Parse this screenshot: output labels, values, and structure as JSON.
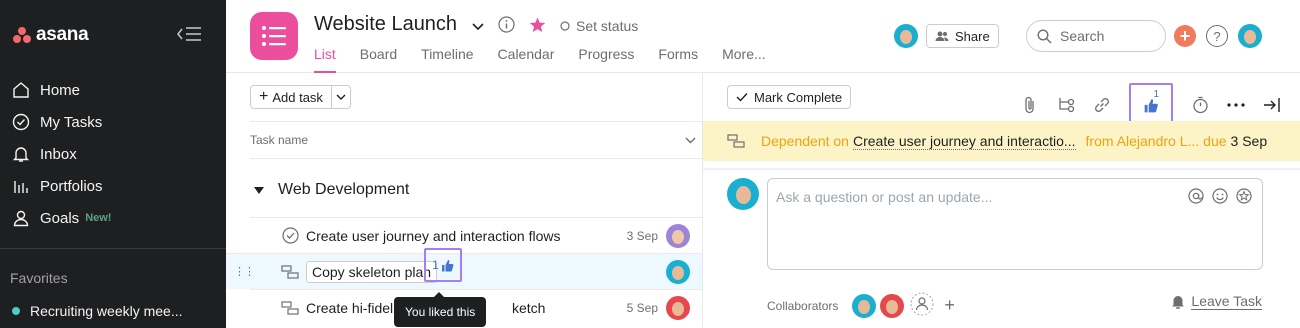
{
  "sidebar": {
    "logo_text": "asana",
    "nav": [
      {
        "label": "Home",
        "icon": "home-icon"
      },
      {
        "label": "My Tasks",
        "icon": "check-circle-icon"
      },
      {
        "label": "Inbox",
        "icon": "bell-icon"
      },
      {
        "label": "Portfolios",
        "icon": "bar-chart-icon"
      },
      {
        "label": "Goals",
        "icon": "person-icon",
        "badge": "New!"
      }
    ],
    "favorites_title": "Favorites",
    "favorites": [
      {
        "label": "Recruiting weekly mee...",
        "color": "#4ecbc4"
      }
    ]
  },
  "header": {
    "project_title": "Website Launch",
    "set_status": "Set status",
    "tabs": [
      "List",
      "Board",
      "Timeline",
      "Calendar",
      "Progress",
      "Forms",
      "More..."
    ],
    "active_tab": "List",
    "share_label": "Share",
    "search_placeholder": "Search",
    "brand_color": "#ea4e9d"
  },
  "list": {
    "add_task_label": "Add task",
    "column_task_name": "Task name",
    "section_title": "Web Development",
    "tasks": [
      {
        "name": "Create user journey and interaction flows",
        "due": "3 Sep"
      },
      {
        "name": "Copy skeleton plan",
        "likes": "1"
      },
      {
        "name": "Create hi-fideli",
        "name_end": "ketch",
        "due": "5 Sep"
      }
    ],
    "tooltip": "You liked this"
  },
  "detail": {
    "mark_complete_label": "Mark Complete",
    "like_count": "1",
    "dependency": {
      "prefix": "Dependent on",
      "task": "Create user journey and interactio...",
      "from": "from Alejandro L...",
      "due_label": "due",
      "due_date": "3 Sep"
    },
    "comment_placeholder": "Ask a question or post an update...",
    "collaborators_label": "Collaborators",
    "leave_task_label": "Leave Task"
  }
}
